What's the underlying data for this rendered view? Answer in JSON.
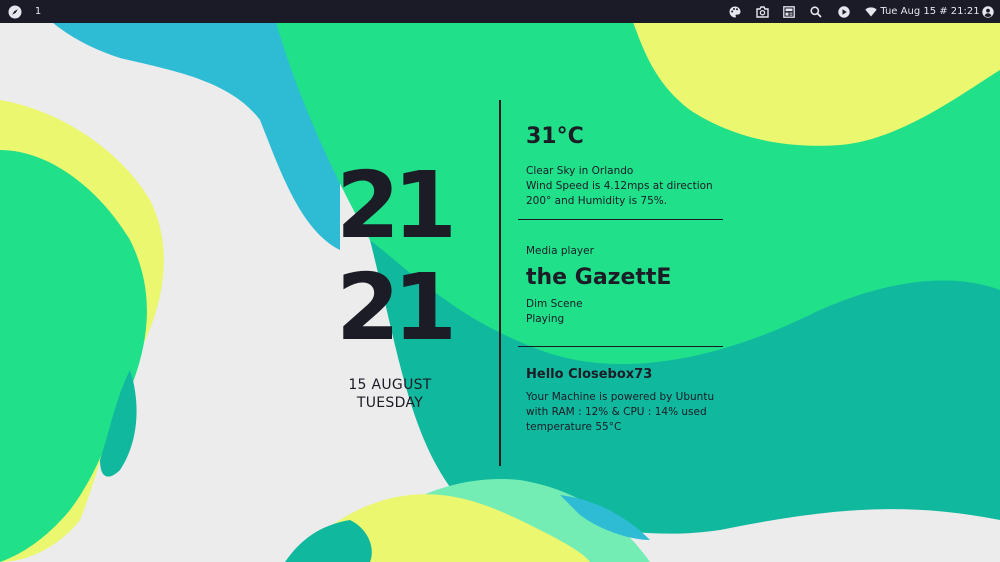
{
  "topbar": {
    "workspace": "1",
    "datetime": "Tue Aug 15 # 21:21",
    "icons": [
      "compass-icon",
      "palette-icon",
      "camera-icon",
      "layout-icon",
      "search-icon",
      "play-icon",
      "wifi-icon",
      "user-icon"
    ]
  },
  "clock": {
    "hour": "21",
    "minute": "21",
    "date": "15 AUGUST",
    "day": "TUESDAY"
  },
  "weather": {
    "temperature": "31°C",
    "line1": "Clear Sky in Orlando",
    "line2": "Wind Speed is 4.12mps at direction",
    "line3": "200° and Humidity is 75%."
  },
  "media": {
    "label": "Media player",
    "artist": "the GazettE",
    "track": "Dim Scene",
    "status": "Playing"
  },
  "system": {
    "greeting": "Hello Closebox73",
    "line1": "Your Machine is powered by Ubuntu",
    "line2": "with RAM : 12% & CPU : 14% used",
    "line3": "temperature 55°C"
  },
  "colors": {
    "background": "#ececec",
    "green": "#20e08a",
    "teal": "#10b89e",
    "blue": "#2ebbd4",
    "yellow": "#ebf76f",
    "mint": "#74edb5",
    "text": "#1c1c26",
    "topbar": "#1b1b27"
  }
}
